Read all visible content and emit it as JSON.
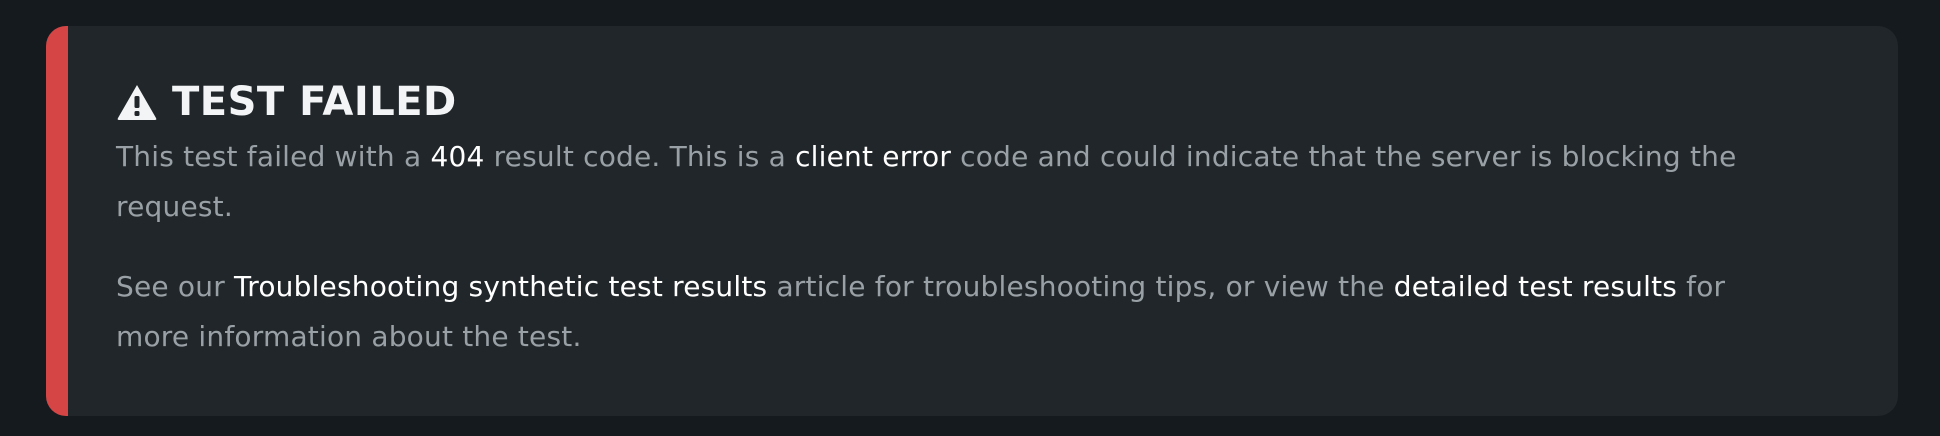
{
  "alert": {
    "title": "TEST FAILED",
    "icon": "warning-icon",
    "colors": {
      "stripe": "#d64545",
      "background": "#20262a",
      "text": "#9aa1a6",
      "highlight": "#ffffff"
    },
    "paragraph1": {
      "p1": "This test failed with a ",
      "code": "404",
      "p2": " result code. This is a ",
      "error_type": "client error",
      "p3": " code and could indicate that the server is blocking the request."
    },
    "paragraph2": {
      "p1": "See our ",
      "link1": "Troubleshooting synthetic test results",
      "p2": " article for troubleshooting tips, or view the ",
      "link2": "detailed test results",
      "p3": " for more information about the test."
    }
  }
}
